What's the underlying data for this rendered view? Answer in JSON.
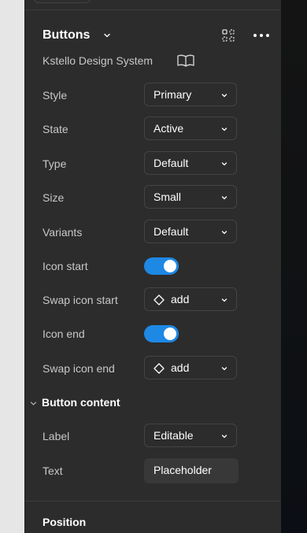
{
  "panel": {
    "title": "Buttons",
    "subtitle": "Kstello Design System"
  },
  "properties": {
    "style": {
      "label": "Style",
      "value": "Primary"
    },
    "state": {
      "label": "State",
      "value": "Active"
    },
    "type": {
      "label": "Type",
      "value": "Default"
    },
    "size": {
      "label": "Size",
      "value": "Small"
    },
    "variants": {
      "label": "Variants",
      "value": "Default"
    },
    "icon_start": {
      "label": "Icon start",
      "enabled": true
    },
    "swap_icon_start": {
      "label": "Swap icon start",
      "value": "add",
      "icon": "diamond-icon"
    },
    "icon_end": {
      "label": "Icon end",
      "enabled": true
    },
    "swap_icon_end": {
      "label": "Swap icon end",
      "value": "add",
      "icon": "diamond-icon"
    }
  },
  "button_content": {
    "section_title": "Button content",
    "label": {
      "label": "Label",
      "value": "Editable"
    },
    "text": {
      "label": "Text",
      "value": "Placeholder"
    }
  },
  "position": {
    "title": "Position"
  },
  "colors": {
    "panel_bg": "#2c2c2c",
    "toggle_on": "#1e88e5",
    "muted_text": "#c8c8c8"
  }
}
